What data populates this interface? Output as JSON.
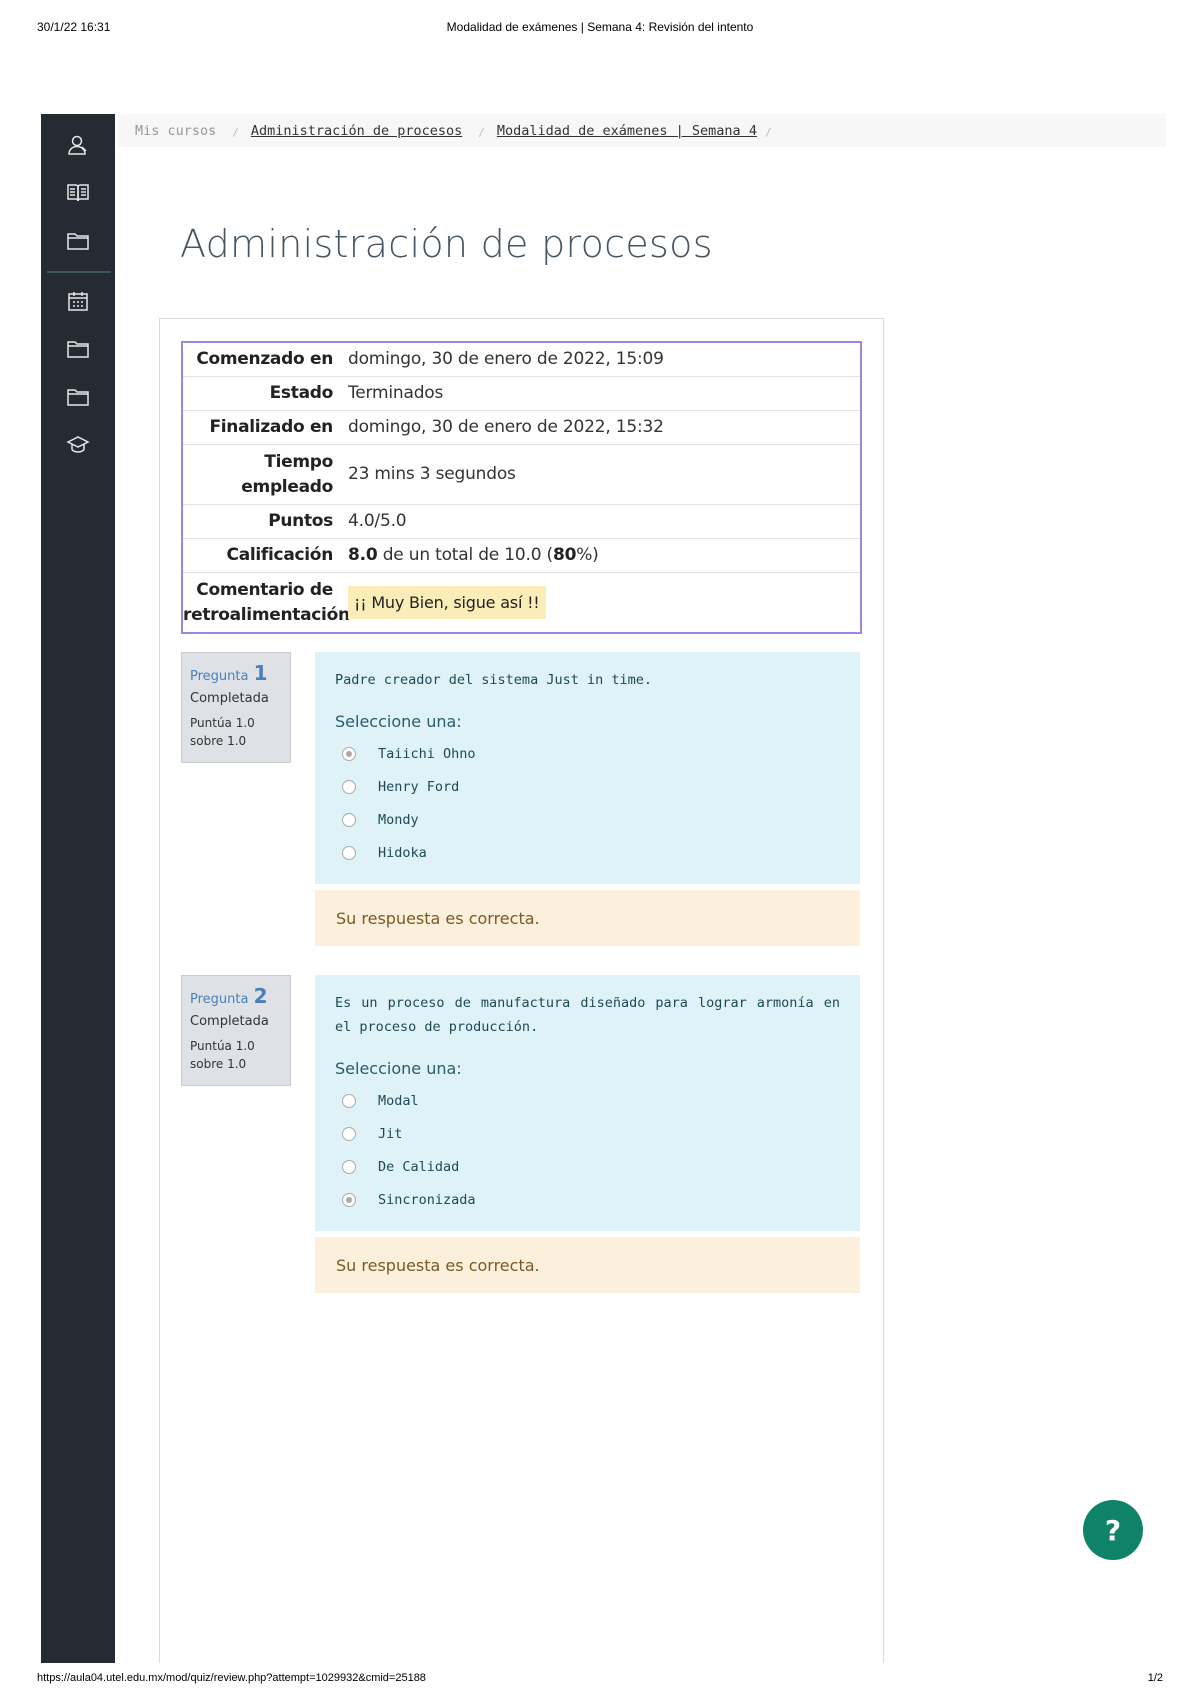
{
  "print_header": {
    "datetime": "30/1/22 16:31",
    "title": "Modalidad de exámenes | Semana 4: Revisión del intento"
  },
  "print_footer": {
    "url": "https://aula04.utel.edu.mx/mod/quiz/review.php?attempt=1029932&cmid=25188",
    "page": "1/2"
  },
  "sidebar": {
    "items": [
      {
        "icon": "user-icon"
      },
      {
        "icon": "book-icon"
      },
      {
        "icon": "folder-icon"
      },
      {
        "icon": "calendar-icon"
      },
      {
        "icon": "folder-icon"
      },
      {
        "icon": "folder-icon"
      },
      {
        "icon": "graduation-cap-icon"
      }
    ]
  },
  "breadcrumb": {
    "items": [
      "Mis cursos",
      "Administración de procesos",
      "Modalidad de exámenes | Semana 4"
    ]
  },
  "page_title": "Administración de procesos",
  "summary": {
    "started_label": "Comenzado en",
    "started_value": "domingo, 30 de enero de 2022, 15:09",
    "state_label": "Estado",
    "state_value": "Terminados",
    "finished_label": "Finalizado en",
    "finished_value": "domingo, 30 de enero de 2022, 15:32",
    "time_label_1": "Tiempo",
    "time_label_2": "empleado",
    "time_value": "23 mins 3 segundos",
    "points_label": "Puntos",
    "points_value": "4.0/5.0",
    "grade_label": "Calificación",
    "grade_value": "8.0",
    "grade_mid": " de un total de 10.0 (",
    "grade_percent": "80",
    "grade_end": "%)",
    "feedback_label_1": "Comentario de",
    "feedback_label_2": "retroalimentación",
    "feedback_value": "¡¡ Muy Bien, sigue así !!"
  },
  "questions": [
    {
      "label": "Pregunta",
      "number": "1",
      "state": "Completada",
      "grade_line1": "Puntúa 1.0",
      "grade_line2": "sobre 1.0",
      "text": "Padre creador del sistema Just in time.",
      "prompt": "Seleccione una:",
      "options": [
        "Taiichi Ohno",
        "Henry Ford",
        "Mondy",
        "Hidoka"
      ],
      "selected": 0,
      "outcome": "Su respuesta es correcta."
    },
    {
      "label": "Pregunta",
      "number": "2",
      "state": "Completada",
      "grade_line1": "Puntúa 1.0",
      "grade_line2": "sobre 1.0",
      "text": "Es un proceso de manufactura diseñado para lograr armonía en el proceso de producción.",
      "prompt": "Seleccione una:",
      "options": [
        "Modal",
        "Jit",
        "De Calidad",
        "Sincronizada"
      ],
      "selected": 3,
      "outcome": "Su respuesta es correcta."
    }
  ],
  "help_button": {
    "label": "?",
    "color": "#0f8368"
  },
  "colors": {
    "sidebar": "#262b33",
    "summary_border": "#9f85e3",
    "question_bg": "#def2f8",
    "outcome_bg": "#fcefdc",
    "feedback_bg": "#fbedb8"
  }
}
